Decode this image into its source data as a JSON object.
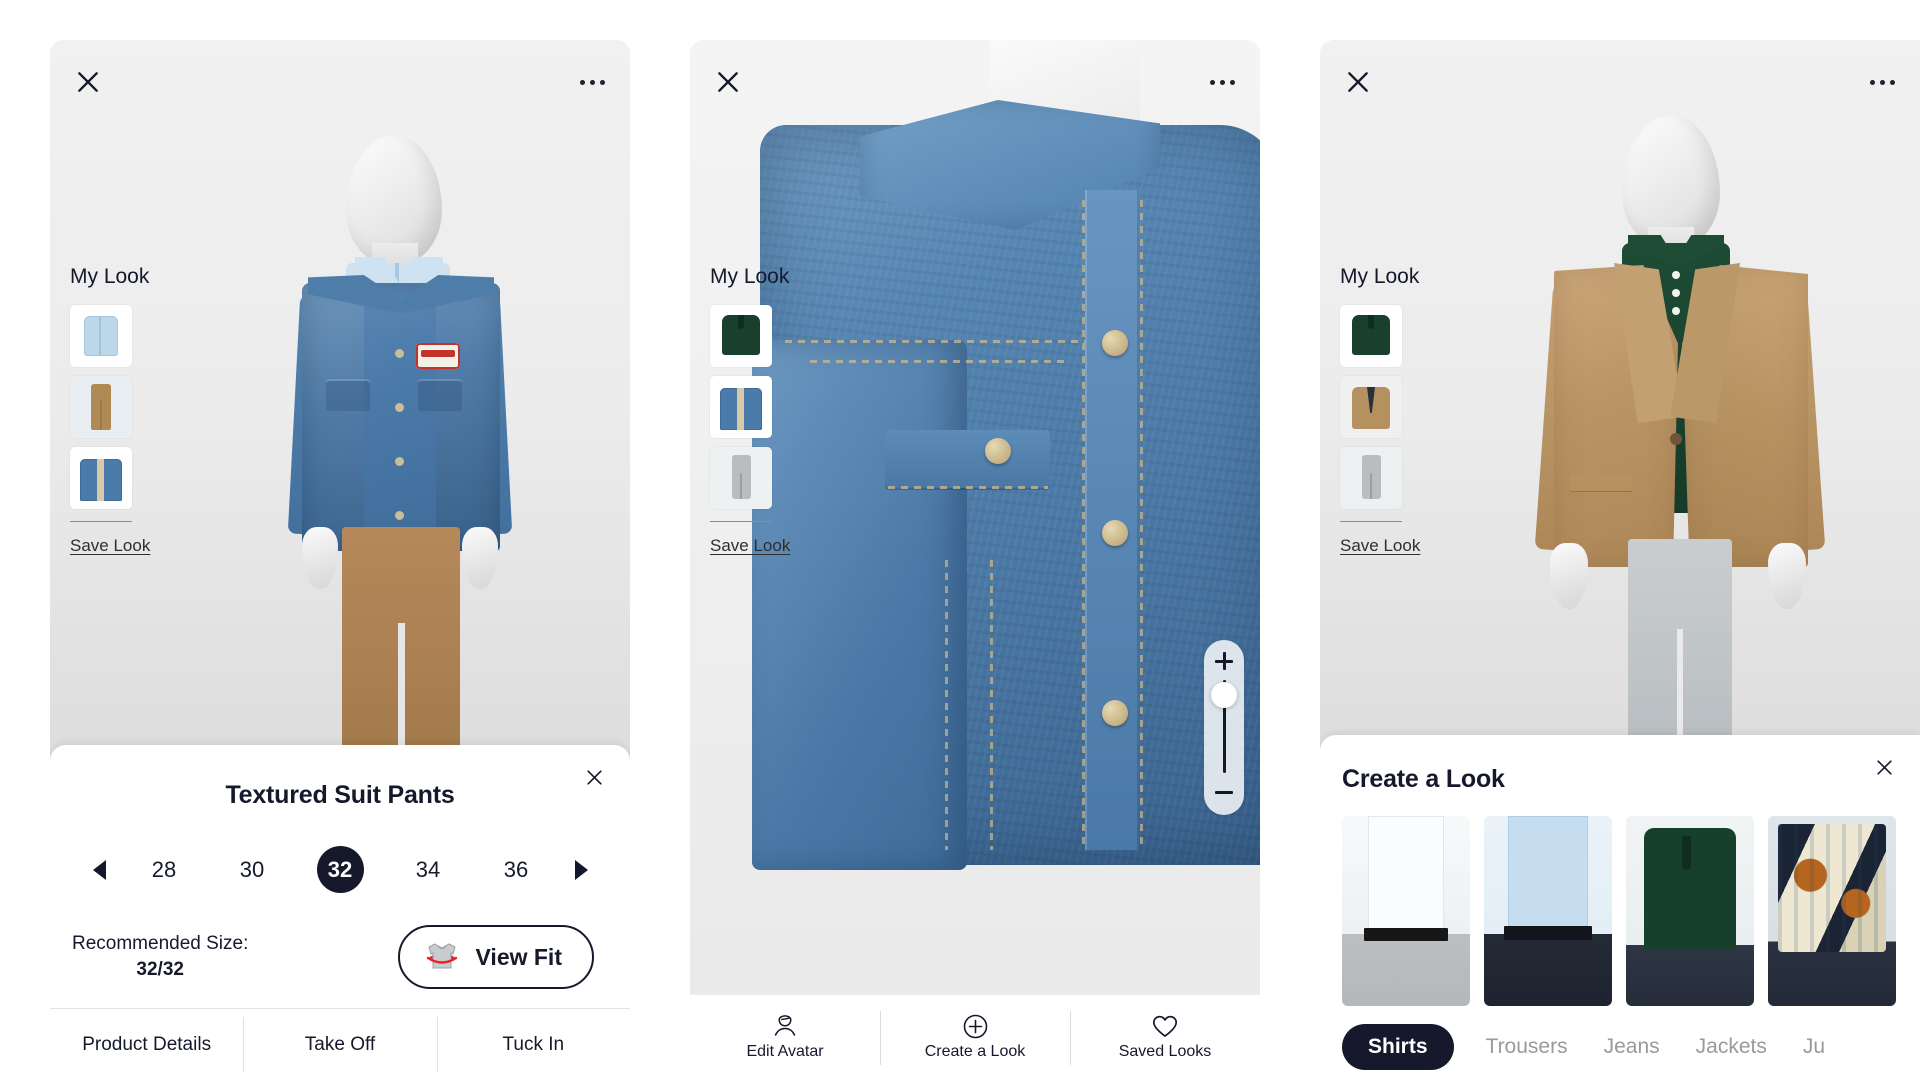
{
  "panels": [
    {
      "id": "product-detail",
      "top_bar": {
        "close_icon": "close-icon",
        "more_icon": "more-options-icon"
      },
      "my_look": {
        "title": "My Look",
        "items": [
          {
            "name": "light-blue-shirt"
          },
          {
            "name": "tan-trousers"
          },
          {
            "name": "denim-jacket"
          }
        ],
        "save_label": "Save Look"
      },
      "zoom_control": {
        "plus": "+",
        "minus": "",
        "handle_position_pct": 100
      },
      "sheet": {
        "title": "Textured Suit Pants",
        "close_icon": "close-icon",
        "prev_icon": "arrow-left-icon",
        "next_icon": "arrow-right-icon",
        "sizes": [
          "28",
          "30",
          "32",
          "34",
          "36"
        ],
        "selected_size": "32",
        "recommended_label": "Recommended Size:",
        "recommended_value": "32/32",
        "view_fit_label": "View Fit",
        "view_fit_icon": "fit-garment-icon",
        "tabs": [
          "Product Details",
          "Take Off",
          "Tuck In"
        ]
      }
    },
    {
      "id": "zoomed-garment",
      "top_bar": {
        "close_icon": "close-icon",
        "more_icon": "more-options-icon"
      },
      "my_look": {
        "title": "My Look",
        "items": [
          {
            "name": "green-polo"
          },
          {
            "name": "denim-jacket"
          },
          {
            "name": "grey-trousers"
          }
        ],
        "save_label": "Save Look"
      },
      "zoom_control": {
        "plus": "+",
        "minus": "",
        "handle_position_pct": 18
      },
      "bottom_nav": [
        {
          "label": "Edit Avatar",
          "icon": "avatar-icon"
        },
        {
          "label": "Create a Look",
          "icon": "plus-circle-icon"
        },
        {
          "label": "Saved Looks",
          "icon": "heart-icon"
        }
      ]
    },
    {
      "id": "create-a-look",
      "top_bar": {
        "close_icon": "close-icon",
        "more_icon": "more-options-icon"
      },
      "my_look": {
        "title": "My Look",
        "items": [
          {
            "name": "green-polo"
          },
          {
            "name": "tan-blazer"
          },
          {
            "name": "grey-trousers"
          }
        ],
        "save_label": "Save Look"
      },
      "zoom_control": {
        "plus": "+",
        "minus": "",
        "handle_position_pct": 100
      },
      "sheet": {
        "title": "Create a Look",
        "close_icon": "close-icon",
        "cards": [
          {
            "name": "white-dress-shirt"
          },
          {
            "name": "light-blue-dress-shirt"
          },
          {
            "name": "dark-green-polo"
          },
          {
            "name": "printed-shirt"
          }
        ],
        "categories": [
          "Shirts",
          "Trousers",
          "Jeans",
          "Jackets",
          "Ju"
        ],
        "selected_category": "Shirts"
      }
    }
  ],
  "colors": {
    "accent_dark": "#15192b",
    "text_muted": "#9a9a9a",
    "sheet_bg": "#ffffff",
    "fit_icon_red": "#e8232a"
  }
}
